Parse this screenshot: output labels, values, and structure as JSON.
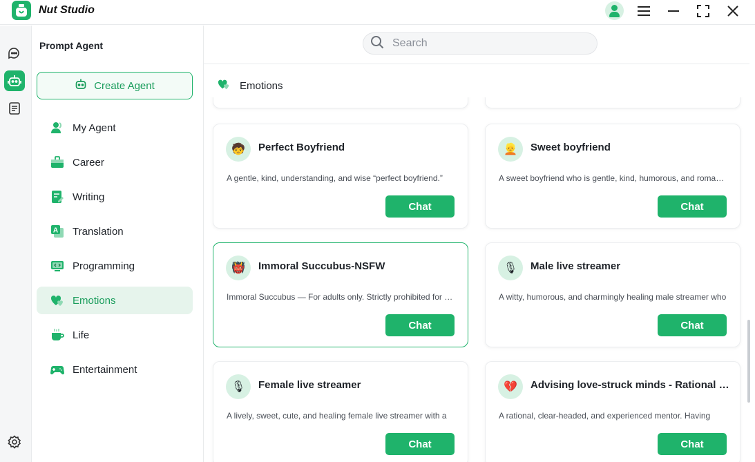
{
  "app": {
    "title": "Nut Studio"
  },
  "sidebar": {
    "title": "Prompt Agent",
    "create_label": "Create Agent",
    "items": [
      {
        "label": "My Agent",
        "icon": "user-icon"
      },
      {
        "label": "Career",
        "icon": "briefcase-icon"
      },
      {
        "label": "Writing",
        "icon": "writing-icon"
      },
      {
        "label": "Translation",
        "icon": "translate-icon"
      },
      {
        "label": "Programming",
        "icon": "code-icon"
      },
      {
        "label": "Emotions",
        "icon": "hearts-icon",
        "active": true
      },
      {
        "label": "Life",
        "icon": "cup-icon"
      },
      {
        "label": "Entertainment",
        "icon": "gamepad-icon"
      }
    ]
  },
  "search": {
    "placeholder": "Search",
    "value": ""
  },
  "section": {
    "title": "Emotions"
  },
  "cards": [
    {
      "title": "Perfect Boyfriend",
      "desc": "A gentle, kind, understanding, and wise “perfect boyfriend.”",
      "emoji": "🧒",
      "chat_label": "Chat"
    },
    {
      "title": "Sweet boyfriend",
      "desc": "A sweet boyfriend who is gentle, kind, humorous, and romantic.",
      "emoji": "👱",
      "chat_label": "Chat"
    },
    {
      "title": "Immoral Succubus-NSFW",
      "desc": "Immoral Succubus — For adults only. Strictly prohibited for minors.",
      "emoji": "👹",
      "chat_label": "Chat",
      "active": true
    },
    {
      "title": "Male live streamer",
      "desc": "A witty, humorous, and charmingly healing male streamer who",
      "emoji": "🎙",
      "chat_label": "Chat"
    },
    {
      "title": "Female live streamer",
      "desc": "A lively, sweet, cute, and healing female live streamer with a",
      "emoji": "🎙",
      "chat_label": "Chat"
    },
    {
      "title": "Advising love-struck minds - Rational st…",
      "desc": "A rational, clear-headed, and experienced mentor. Having",
      "emoji": "💔",
      "chat_label": "Chat"
    }
  ],
  "colors": {
    "accent": "#1fb36b",
    "accent_light": "#d7f1e3",
    "active_bg": "#e6f4ec"
  }
}
